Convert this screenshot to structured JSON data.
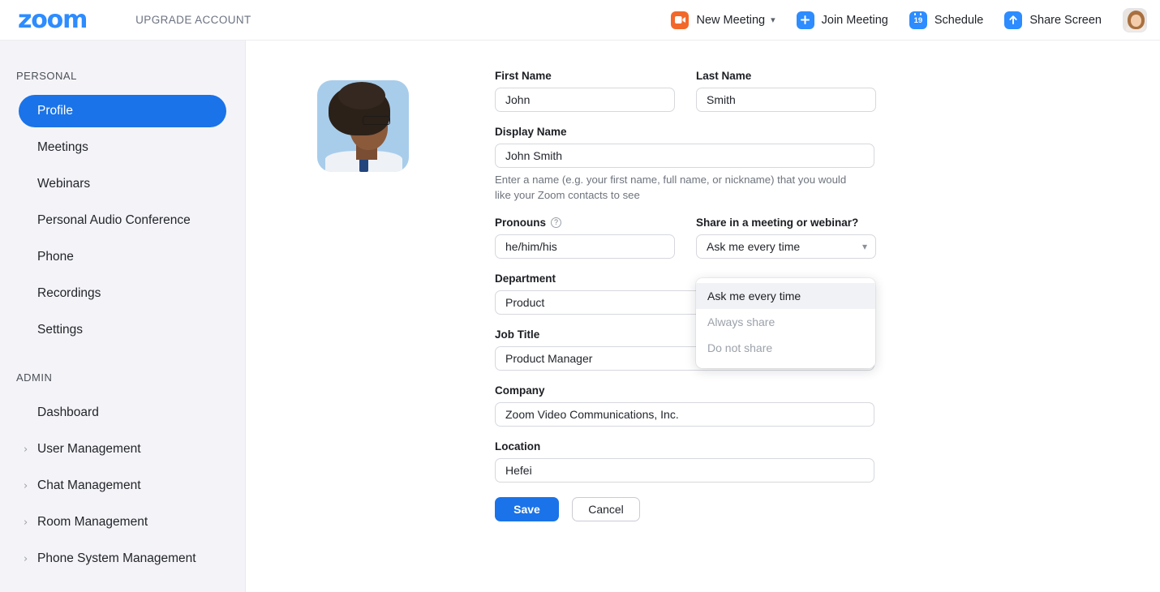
{
  "header": {
    "logo": "zoom",
    "upgrade_label": "UPGRADE ACCOUNT",
    "actions": [
      {
        "label": "New Meeting",
        "icon": "video-camera-icon",
        "has_caret": true
      },
      {
        "label": "Join Meeting",
        "icon": "plus-icon",
        "has_caret": false
      },
      {
        "label": "Schedule",
        "icon": "calendar-icon",
        "calendar_day": "19",
        "has_caret": false
      },
      {
        "label": "Share Screen",
        "icon": "arrow-up-icon",
        "has_caret": false
      }
    ],
    "account_avatar_alt": "User account avatar"
  },
  "sidebar": {
    "sections": [
      {
        "title": "PERSONAL",
        "items": [
          {
            "label": "Profile",
            "active": true,
            "chevron": false
          },
          {
            "label": "Meetings",
            "active": false,
            "chevron": false
          },
          {
            "label": "Webinars",
            "active": false,
            "chevron": false
          },
          {
            "label": "Personal Audio Conference",
            "active": false,
            "chevron": false
          },
          {
            "label": "Phone",
            "active": false,
            "chevron": false
          },
          {
            "label": "Recordings",
            "active": false,
            "chevron": false
          },
          {
            "label": "Settings",
            "active": false,
            "chevron": false
          }
        ]
      },
      {
        "title": "ADMIN",
        "items": [
          {
            "label": "Dashboard",
            "active": false,
            "chevron": false
          },
          {
            "label": "User Management",
            "active": false,
            "chevron": true
          },
          {
            "label": "Chat Management",
            "active": false,
            "chevron": true
          },
          {
            "label": "Room Management",
            "active": false,
            "chevron": true
          },
          {
            "label": "Phone System Management",
            "active": false,
            "chevron": true
          }
        ]
      }
    ]
  },
  "profile": {
    "avatar_alt": "Profile photo",
    "fields": {
      "first_name": {
        "label": "First Name",
        "value": "John"
      },
      "last_name": {
        "label": "Last Name",
        "value": "Smith"
      },
      "display_name": {
        "label": "Display Name",
        "value": "John Smith",
        "hint": "Enter a name (e.g. your first name, full name, or nickname) that you would like your Zoom contacts to see"
      },
      "pronouns": {
        "label": "Pronouns",
        "value": "he/him/his",
        "help_icon": "question-mark-icon"
      },
      "share_setting": {
        "label": "Share in a meeting or webinar?",
        "value": "Ask me every time",
        "caret_icon": "chevron-down-icon",
        "open": true,
        "options": [
          {
            "label": "Ask me every time",
            "selected": true
          },
          {
            "label": "Always share",
            "selected": false
          },
          {
            "label": "Do not share",
            "selected": false
          }
        ]
      },
      "department": {
        "label": "Department",
        "value": "Product"
      },
      "job_title": {
        "label": "Job Title",
        "value": "Product Manager"
      },
      "company": {
        "label": "Company",
        "value": "Zoom Video Communications, Inc."
      },
      "location": {
        "label": "Location",
        "value": "Hefei"
      }
    },
    "buttons": {
      "save": "Save",
      "cancel": "Cancel"
    }
  },
  "colors": {
    "brand_blue": "#2d8cff",
    "active_blue": "#1a73e8",
    "orange": "#f2682a",
    "sidebar_bg": "#f4f4f8"
  }
}
